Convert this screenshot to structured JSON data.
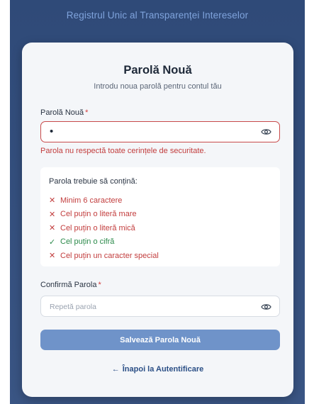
{
  "app": {
    "title": "Registrul Unic al Transparenței Intereselor"
  },
  "card": {
    "title": "Parolă Nouă",
    "subtitle": "Introdu noua parolă pentru contul tău"
  },
  "new_password": {
    "label": "Parolă Nouă",
    "required_mark": "*",
    "value": "•",
    "icon": "eye-icon",
    "error": "Parola nu respectă toate cerințele de securitate."
  },
  "requirements": {
    "title": "Parola trebuie să conțină:",
    "items": [
      {
        "mark": "✕",
        "label": "Minim 6 caractere",
        "status": "fail"
      },
      {
        "mark": "✕",
        "label": "Cel puțin o literă mare",
        "status": "fail"
      },
      {
        "mark": "✕",
        "label": "Cel puțin o literă mică",
        "status": "fail"
      },
      {
        "mark": "✓",
        "label": "Cel puțin o cifră",
        "status": "pass"
      },
      {
        "mark": "✕",
        "label": "Cel puțin un caracter special",
        "status": "fail"
      }
    ]
  },
  "confirm_password": {
    "label": "Confirmă Parola",
    "required_mark": "*",
    "placeholder": "Repetă parola",
    "icon": "eye-icon"
  },
  "actions": {
    "save_label": "Salvează Parola Nouă",
    "back_arrow": "←",
    "back_label": "Înapoi la Autentificare"
  },
  "colors": {
    "background": "#2f4a78",
    "accent": "#6f93c9",
    "error": "#c23d3d",
    "success": "#2b8a4a"
  }
}
